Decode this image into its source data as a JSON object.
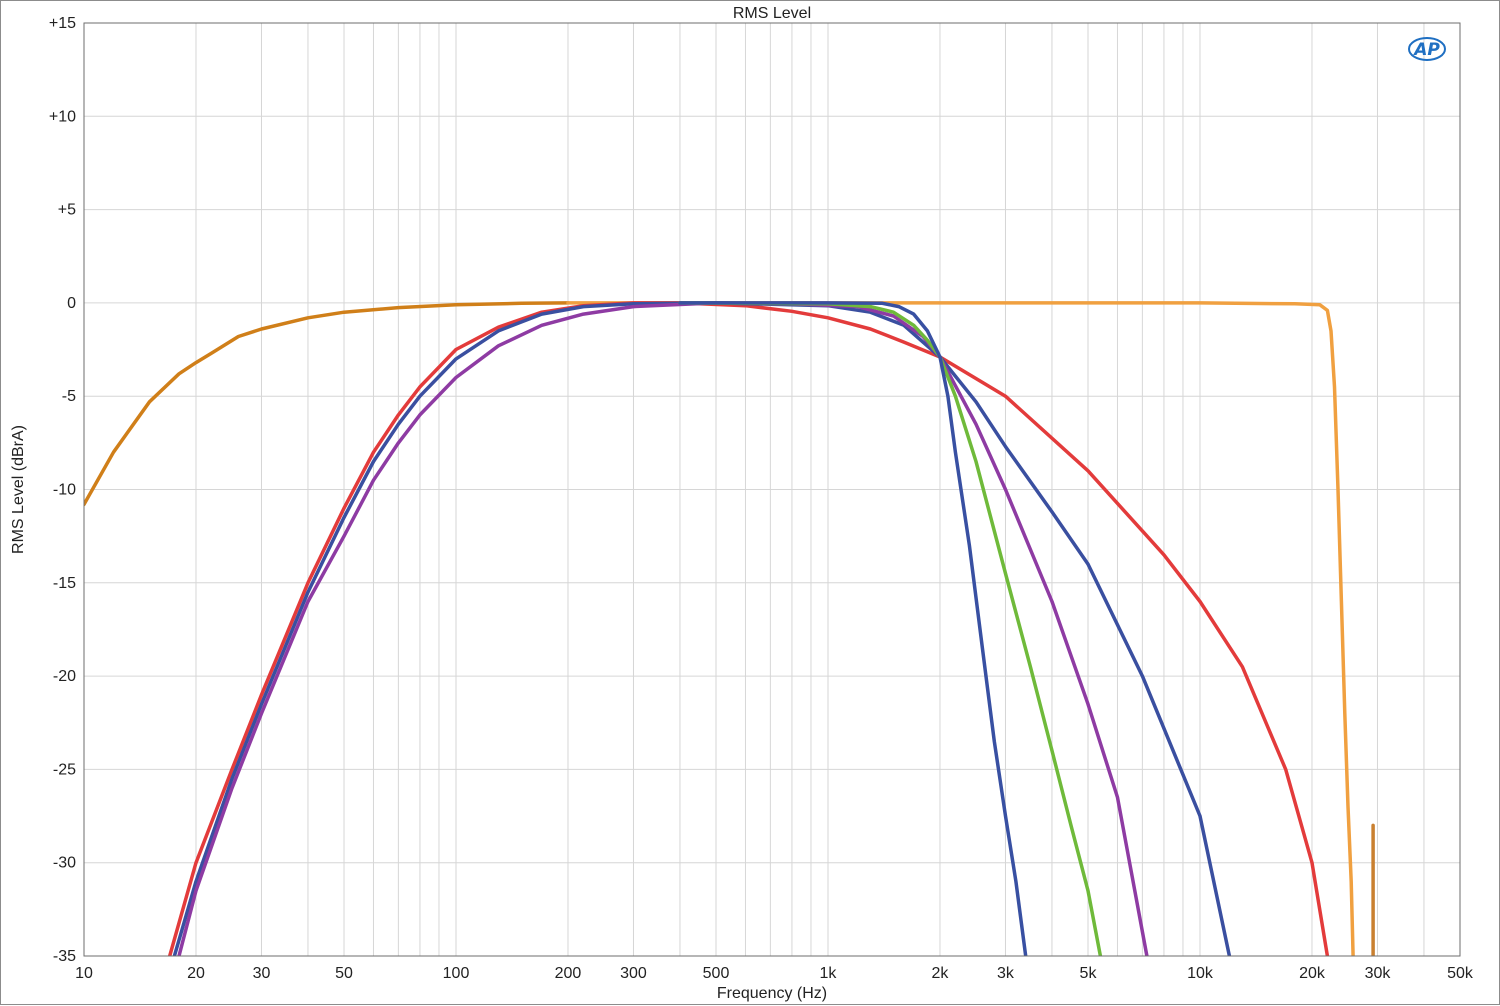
{
  "chart_data": {
    "type": "line",
    "title": "RMS Level",
    "xlabel": "Frequency (Hz)",
    "ylabel": "RMS Level (dBrA)",
    "x_scale": "log",
    "xlim": [
      10,
      50000
    ],
    "ylim": [
      -35,
      15
    ],
    "grid": true,
    "x_ticks": [
      {
        "value": 10,
        "label": "10"
      },
      {
        "value": 20,
        "label": "20"
      },
      {
        "value": 30,
        "label": "30"
      },
      {
        "value": 50,
        "label": "50"
      },
      {
        "value": 100,
        "label": "100"
      },
      {
        "value": 200,
        "label": "200"
      },
      {
        "value": 300,
        "label": "300"
      },
      {
        "value": 500,
        "label": "500"
      },
      {
        "value": 1000,
        "label": "1k"
      },
      {
        "value": 2000,
        "label": "2k"
      },
      {
        "value": 3000,
        "label": "3k"
      },
      {
        "value": 5000,
        "label": "5k"
      },
      {
        "value": 10000,
        "label": "10k"
      },
      {
        "value": 20000,
        "label": "20k"
      },
      {
        "value": 30000,
        "label": "30k"
      },
      {
        "value": 50000,
        "label": "50k"
      }
    ],
    "y_ticks": [
      {
        "value": 15,
        "label": "+15"
      },
      {
        "value": 10,
        "label": "+10"
      },
      {
        "value": 5,
        "label": "+5"
      },
      {
        "value": 0,
        "label": "0"
      },
      {
        "value": -5,
        "label": "-5"
      },
      {
        "value": -10,
        "label": "-10"
      },
      {
        "value": -15,
        "label": "-15"
      },
      {
        "value": -20,
        "label": "-20"
      },
      {
        "value": -25,
        "label": "-25"
      },
      {
        "value": -30,
        "label": "-30"
      },
      {
        "value": -35,
        "label": "-35"
      }
    ],
    "series": [
      {
        "color": "#d07f19",
        "points": [
          [
            10,
            -10.8
          ],
          [
            12,
            -8
          ],
          [
            15,
            -5.3
          ],
          [
            18,
            -3.8
          ],
          [
            20,
            -3.2
          ],
          [
            22,
            -2.7
          ],
          [
            26,
            -1.8
          ],
          [
            30,
            -1.4
          ],
          [
            40,
            -0.8
          ],
          [
            50,
            -0.5
          ],
          [
            70,
            -0.25
          ],
          [
            100,
            -0.1
          ],
          [
            150,
            -0.02
          ],
          [
            200,
            0
          ]
        ]
      },
      {
        "color": "#f0a040",
        "points": [
          [
            200,
            0
          ],
          [
            1000,
            0
          ],
          [
            5000,
            0
          ],
          [
            10000,
            0
          ],
          [
            18000,
            -0.05
          ],
          [
            21000,
            -0.1
          ],
          [
            22000,
            -0.4
          ],
          [
            22500,
            -1.5
          ],
          [
            23000,
            -4.5
          ],
          [
            23500,
            -10
          ],
          [
            24000,
            -16
          ],
          [
            24500,
            -22
          ],
          [
            25000,
            -27
          ],
          [
            25500,
            -31
          ],
          [
            25800,
            -35
          ]
        ]
      },
      {
        "color": "#c98030",
        "points": [
          [
            29200,
            -35
          ],
          [
            29200,
            -28
          ]
        ]
      },
      {
        "color": "#e33b3b",
        "points": [
          [
            17,
            -35
          ],
          [
            20,
            -30
          ],
          [
            25,
            -25
          ],
          [
            30,
            -21
          ],
          [
            40,
            -15
          ],
          [
            50,
            -11
          ],
          [
            60,
            -8
          ],
          [
            70,
            -6
          ],
          [
            80,
            -4.5
          ],
          [
            100,
            -2.5
          ],
          [
            130,
            -1.3
          ],
          [
            170,
            -0.5
          ],
          [
            220,
            -0.15
          ],
          [
            300,
            0
          ],
          [
            400,
            0
          ],
          [
            600,
            -0.15
          ],
          [
            800,
            -0.45
          ],
          [
            1000,
            -0.8
          ],
          [
            1300,
            -1.4
          ],
          [
            1600,
            -2.1
          ],
          [
            2000,
            -2.9
          ],
          [
            3000,
            -5
          ],
          [
            5000,
            -9
          ],
          [
            8000,
            -13.5
          ],
          [
            10000,
            -16
          ],
          [
            13000,
            -19.5
          ],
          [
            17000,
            -25
          ],
          [
            20000,
            -30
          ],
          [
            22000,
            -35
          ]
        ]
      },
      {
        "color": "#3a4fa0",
        "points": [
          [
            17.5,
            -35
          ],
          [
            20,
            -31
          ],
          [
            25,
            -25.5
          ],
          [
            30,
            -21.5
          ],
          [
            40,
            -15.5
          ],
          [
            50,
            -11.5
          ],
          [
            60,
            -8.5
          ],
          [
            70,
            -6.5
          ],
          [
            80,
            -5
          ],
          [
            100,
            -3
          ],
          [
            130,
            -1.5
          ],
          [
            170,
            -0.6
          ],
          [
            220,
            -0.2
          ],
          [
            300,
            -0.05
          ],
          [
            500,
            0
          ],
          [
            1000,
            -0.15
          ],
          [
            1300,
            -0.5
          ],
          [
            1600,
            -1.2
          ],
          [
            2000,
            -2.9
          ],
          [
            2500,
            -5.3
          ],
          [
            3000,
            -7.7
          ],
          [
            4000,
            -11.2
          ],
          [
            5000,
            -14
          ],
          [
            7000,
            -20
          ],
          [
            10000,
            -27.5
          ],
          [
            12000,
            -35
          ]
        ]
      },
      {
        "color": "#8e3ba3",
        "points": [
          [
            18,
            -35
          ],
          [
            20,
            -31.5
          ],
          [
            25,
            -26
          ],
          [
            30,
            -22
          ],
          [
            40,
            -16
          ],
          [
            50,
            -12.5
          ],
          [
            60,
            -9.5
          ],
          [
            70,
            -7.5
          ],
          [
            80,
            -6
          ],
          [
            100,
            -4
          ],
          [
            130,
            -2.3
          ],
          [
            170,
            -1.2
          ],
          [
            220,
            -0.6
          ],
          [
            300,
            -0.2
          ],
          [
            500,
            0
          ],
          [
            800,
            -0.05
          ],
          [
            1200,
            -0.2
          ],
          [
            1500,
            -0.7
          ],
          [
            1800,
            -1.8
          ],
          [
            2000,
            -2.9
          ],
          [
            2500,
            -6.5
          ],
          [
            3000,
            -10
          ],
          [
            4000,
            -16
          ],
          [
            5000,
            -21.5
          ],
          [
            6000,
            -26.5
          ],
          [
            7200,
            -35
          ]
        ]
      },
      {
        "color": "#6fba3a",
        "points": [
          [
            400,
            0
          ],
          [
            1000,
            -0.05
          ],
          [
            1300,
            -0.2
          ],
          [
            1500,
            -0.5
          ],
          [
            1700,
            -1.2
          ],
          [
            1850,
            -2
          ],
          [
            2000,
            -2.9
          ],
          [
            2200,
            -5
          ],
          [
            2500,
            -8.5
          ],
          [
            3000,
            -14.5
          ],
          [
            3500,
            -19.5
          ],
          [
            4000,
            -24
          ],
          [
            4500,
            -28
          ],
          [
            5000,
            -31.5
          ],
          [
            5400,
            -35
          ]
        ]
      },
      {
        "color": "#3850a2",
        "points": [
          [
            400,
            0
          ],
          [
            1000,
            0
          ],
          [
            1400,
            -0.02
          ],
          [
            1550,
            -0.2
          ],
          [
            1700,
            -0.6
          ],
          [
            1850,
            -1.5
          ],
          [
            2000,
            -2.9
          ],
          [
            2100,
            -5
          ],
          [
            2200,
            -8
          ],
          [
            2400,
            -13
          ],
          [
            2600,
            -18.5
          ],
          [
            2800,
            -23.5
          ],
          [
            3000,
            -27.5
          ],
          [
            3200,
            -31
          ],
          [
            3400,
            -35
          ]
        ]
      }
    ]
  },
  "logo": {
    "label": "AP"
  }
}
